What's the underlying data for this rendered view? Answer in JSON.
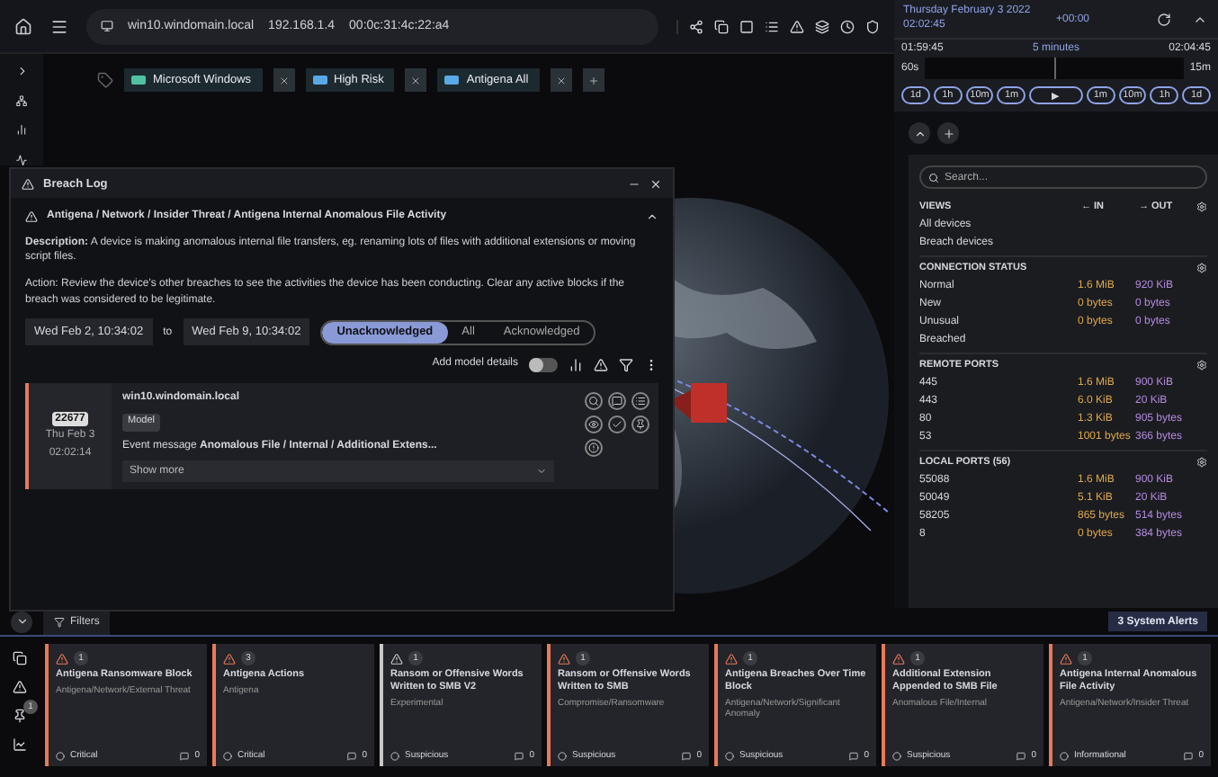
{
  "topbar": {
    "device": "win10.windomain.local",
    "ip": "192.168.1.4",
    "mac": "00:0c:31:4c:22:a4"
  },
  "tags": [
    {
      "label": "Microsoft Windows",
      "color": "#4fc3a1"
    },
    {
      "label": "High Risk",
      "color": "#5aa9e6"
    },
    {
      "label": "Antigena All",
      "color": "#5aa9e6"
    }
  ],
  "breach_log": {
    "title": "Breach Log",
    "path": "Antigena / Network / Insider Threat / Antigena Internal Anomalous File Activity",
    "description": "**Description:** A device is making anomalous internal file transfers, eg. renaming lots of files with additional extensions or moving script files.",
    "action": "Action: Review the device's other breaches to see the activities the device has been conducting. Clear any active blocks if the breach was considered to be legitimate.",
    "date_from": "Wed Feb 2, 10:34:02",
    "to_label": "to",
    "date_to": "Wed Feb 9, 10:34:02",
    "filters": [
      {
        "label": "Unacknowledged",
        "selected": true
      },
      {
        "label": "All",
        "selected": false
      },
      {
        "label": "Acknowledged",
        "selected": false
      }
    ],
    "model_details": {
      "label": "Add model details",
      "on": false
    },
    "breaches": [
      {
        "id": "22677",
        "date": "Thu Feb 3",
        "time": "02:02:14",
        "host": "win10.windomain.local",
        "tag": "Model",
        "message": "Event message **Anomalous File / Internal / Additional Extens...**",
        "show_more": "Show more",
        "color": "#e8795a"
      }
    ]
  },
  "timeline": {
    "date": "Thursday February 3 2022",
    "time": "02:02:45",
    "offset": "+00:00",
    "start": "01:59:45",
    "span": "5 minutes",
    "end": "02:04:45",
    "left_label": "60s",
    "right_label": "15m",
    "buttons": [
      "1d",
      "1h",
      "10m",
      "1m",
      "▶",
      "1m",
      "10m",
      "1h",
      "1d"
    ]
  },
  "stats": {
    "search": {
      "placeholder": "Search..."
    },
    "views": {
      "title": "VIEWS",
      "in": "← IN",
      "out": "→ OUT",
      "items": [
        "All devices",
        "Breach devices"
      ]
    },
    "sections": [
      {
        "title": "CONNECTION STATUS",
        "rows": [
          [
            "Normal",
            "1.6 MiB",
            "920 KiB"
          ],
          [
            "New",
            "0 bytes",
            "0 bytes"
          ],
          [
            "Unusual",
            "0 bytes",
            "0 bytes"
          ],
          [
            "Breached",
            "",
            ""
          ]
        ]
      },
      {
        "title": "REMOTE PORTS",
        "rows": [
          [
            "445",
            "1.6 MiB",
            "900 KiB"
          ],
          [
            "443",
            "6.0 KiB",
            "20 KiB"
          ],
          [
            "80",
            "1.3 KiB",
            "905 bytes"
          ],
          [
            "53",
            "1001 bytes",
            "366 bytes"
          ]
        ]
      },
      {
        "title": "LOCAL PORTS (56)",
        "rows": [
          [
            "55088",
            "1.6 MiB",
            "900 KiB"
          ],
          [
            "50049",
            "5.1 KiB",
            "20 KiB"
          ],
          [
            "58205",
            "865 bytes",
            "514 bytes"
          ],
          [
            "8",
            "0 bytes",
            "384 bytes"
          ]
        ]
      }
    ]
  },
  "filters_button": "Filters",
  "system_alerts": "3 System Alerts",
  "pinned_count": "1",
  "alerts": [
    {
      "count": "1",
      "title": "Antigena Ransomware Block",
      "category": "Antigena/Network/External Threat",
      "level": "Critical",
      "comments": "0",
      "color": "#e8795a"
    },
    {
      "count": "3",
      "title": "Antigena Actions",
      "category": "Antigena",
      "level": "Critical",
      "comments": "0",
      "color": "#e8795a"
    },
    {
      "count": "1",
      "title": "Ransom or Offensive Words Written to SMB V2",
      "category": "Experimental",
      "level": "Suspicious",
      "comments": "0",
      "color": "#c8c8c8"
    },
    {
      "count": "1",
      "title": "Ransom or Offensive Words Written to SMB",
      "category": "Compromise/Ransomware",
      "level": "Suspicious",
      "comments": "0",
      "color": "#e8795a"
    },
    {
      "count": "1",
      "title": "Antigena Breaches Over Time Block",
      "category": "Antigena/Network/Significant Anomaly",
      "level": "Suspicious",
      "comments": "0",
      "color": "#e8795a"
    },
    {
      "count": "1",
      "title": "Additional Extension Appended to SMB File",
      "category": "Anomalous File/Internal",
      "level": "Suspicious",
      "comments": "0",
      "color": "#e8795a"
    },
    {
      "count": "1",
      "title": "Antigena Internal Anomalous File Activity",
      "category": "Antigena/Network/Insider Threat",
      "level": "Informational",
      "comments": "0",
      "color": "#e8795a"
    }
  ]
}
